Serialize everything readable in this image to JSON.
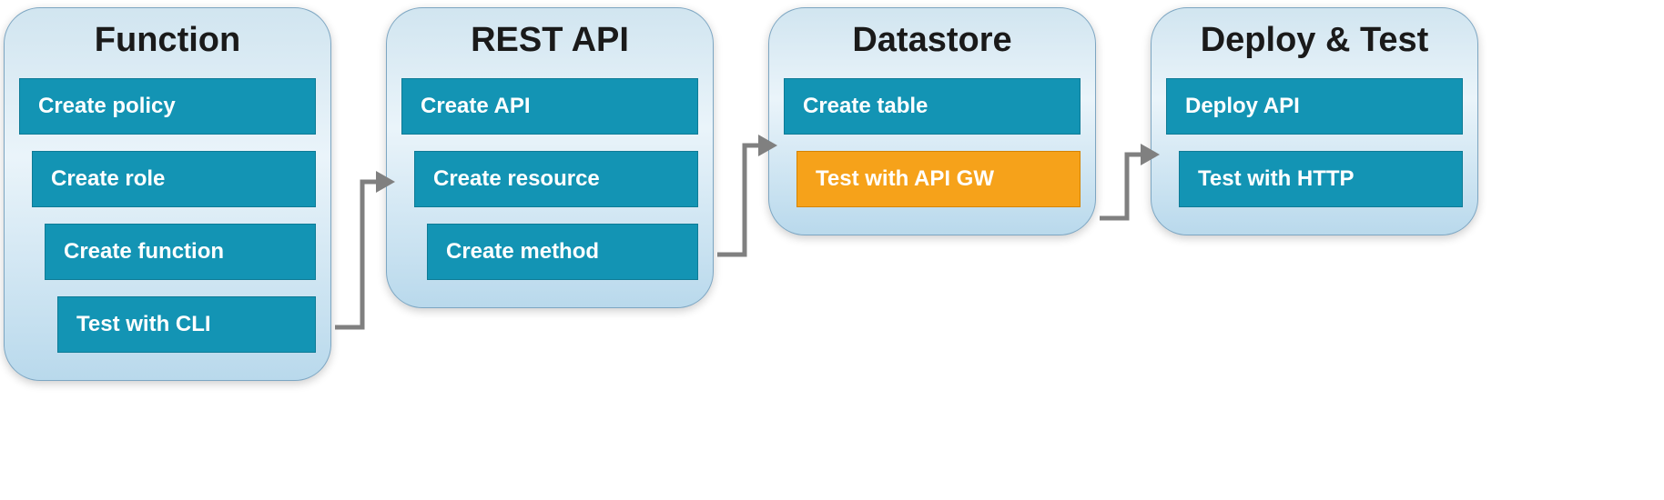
{
  "colors": {
    "card_bg_top": "#d1e5f0",
    "card_bg_bottom": "#b9d9ec",
    "card_border": "#7da6c2",
    "step_default_bg": "#1394b4",
    "step_default_border": "#0e7b96",
    "step_highlight_bg": "#f6a21a",
    "step_highlight_border": "#d68400",
    "arrow": "#808080",
    "text_title": "#1a1a1a",
    "text_step": "#ffffff"
  },
  "stages": [
    {
      "title": "Function",
      "steps": [
        {
          "label": "Create policy",
          "indent": 0,
          "highlight": false
        },
        {
          "label": "Create role",
          "indent": 1,
          "highlight": false
        },
        {
          "label": "Create function",
          "indent": 2,
          "highlight": false
        },
        {
          "label": "Test with CLI",
          "indent": 3,
          "highlight": false
        }
      ]
    },
    {
      "title": "REST API",
      "steps": [
        {
          "label": "Create API",
          "indent": 0,
          "highlight": false
        },
        {
          "label": "Create resource",
          "indent": 1,
          "highlight": false
        },
        {
          "label": "Create method",
          "indent": 2,
          "highlight": false
        }
      ]
    },
    {
      "title": "Datastore",
      "steps": [
        {
          "label": "Create table",
          "indent": 0,
          "highlight": false
        },
        {
          "label": "Test with API GW",
          "indent": 1,
          "highlight": true
        }
      ]
    },
    {
      "title": "Deploy & Test",
      "steps": [
        {
          "label": "Deploy API",
          "indent": 0,
          "highlight": false
        },
        {
          "label": "Test with HTTP",
          "indent": 1,
          "highlight": false
        }
      ]
    }
  ],
  "arrows": [
    {
      "from_stage": 0,
      "to_stage": 1
    },
    {
      "from_stage": 1,
      "to_stage": 2
    },
    {
      "from_stage": 2,
      "to_stage": 3
    }
  ]
}
